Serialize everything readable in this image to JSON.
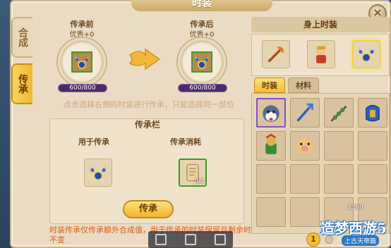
{
  "window": {
    "title": "时装",
    "close_icon": "close-icon"
  },
  "side_tabs": [
    {
      "label": "合成",
      "active": false
    },
    {
      "label": "传承",
      "active": true
    }
  ],
  "left": {
    "source": {
      "header": "传承前",
      "quality": "优秀+0",
      "progress": "600/800",
      "progress_fraction": 0.75
    },
    "target": {
      "header": "传承后",
      "quality": "优秀+0",
      "progress": "600/800",
      "progress_fraction": 0.75
    },
    "hint": "点击选择右侧的时装进行传承，只能选择同一部位",
    "inherit_panel": {
      "title": "传承栏",
      "use_label": "用于传承",
      "cost_label": "传承消耗",
      "cost_count": "0/2"
    },
    "inherit_button": "传承",
    "footer_note": "时装传承仅传承额外合成值，用于传承的时装保留且剩余时间不变"
  },
  "right": {
    "worn_header": "身上时装",
    "tabs": [
      {
        "label": "时装",
        "active": true
      },
      {
        "label": "材料",
        "active": false
      }
    ],
    "page": "1",
    "watermark_num": "4399"
  },
  "logo": {
    "text": "造梦西游5",
    "sub": "上古天帝篇"
  },
  "colors": {
    "panel_bg": "#e9dcc3",
    "accent_gold": "#f3bd37",
    "progress_purple": "#4a2a6a",
    "note_orange": "#e05a1a"
  }
}
